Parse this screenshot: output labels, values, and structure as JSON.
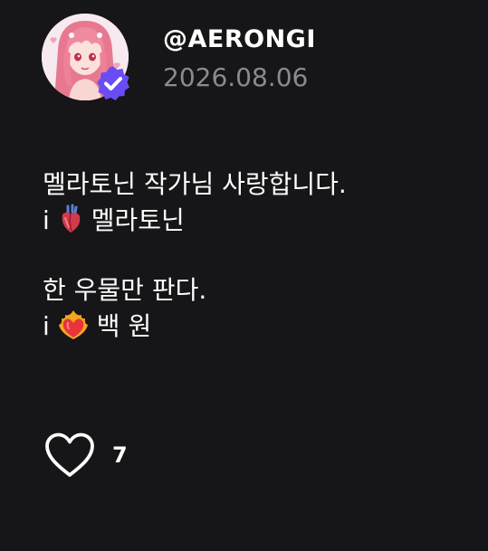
{
  "profile": {
    "handle": "@AERONGI",
    "date": "2026.08.06",
    "avatar": "avatar-pink-hair-girl",
    "verified_icon": "verified-badge-icon",
    "badge_color": "#6a4cf5"
  },
  "post": {
    "line1": "멜라토닌 작가님 사랑합니다.",
    "line2_prefix": "i",
    "line2_emoji": "anatomical-heart-emoji",
    "line2_text": "멜라토닌",
    "line3": "한 우물만 판다.",
    "line4_prefix": "i",
    "line4_emoji": "heart-on-fire-emoji",
    "line4_text": "백 원"
  },
  "actions": {
    "like_icon": "heart-outline-icon",
    "like_count": "7"
  },
  "colors": {
    "background": "#161517",
    "text": "#ffffff",
    "muted": "#8b8a8f"
  }
}
